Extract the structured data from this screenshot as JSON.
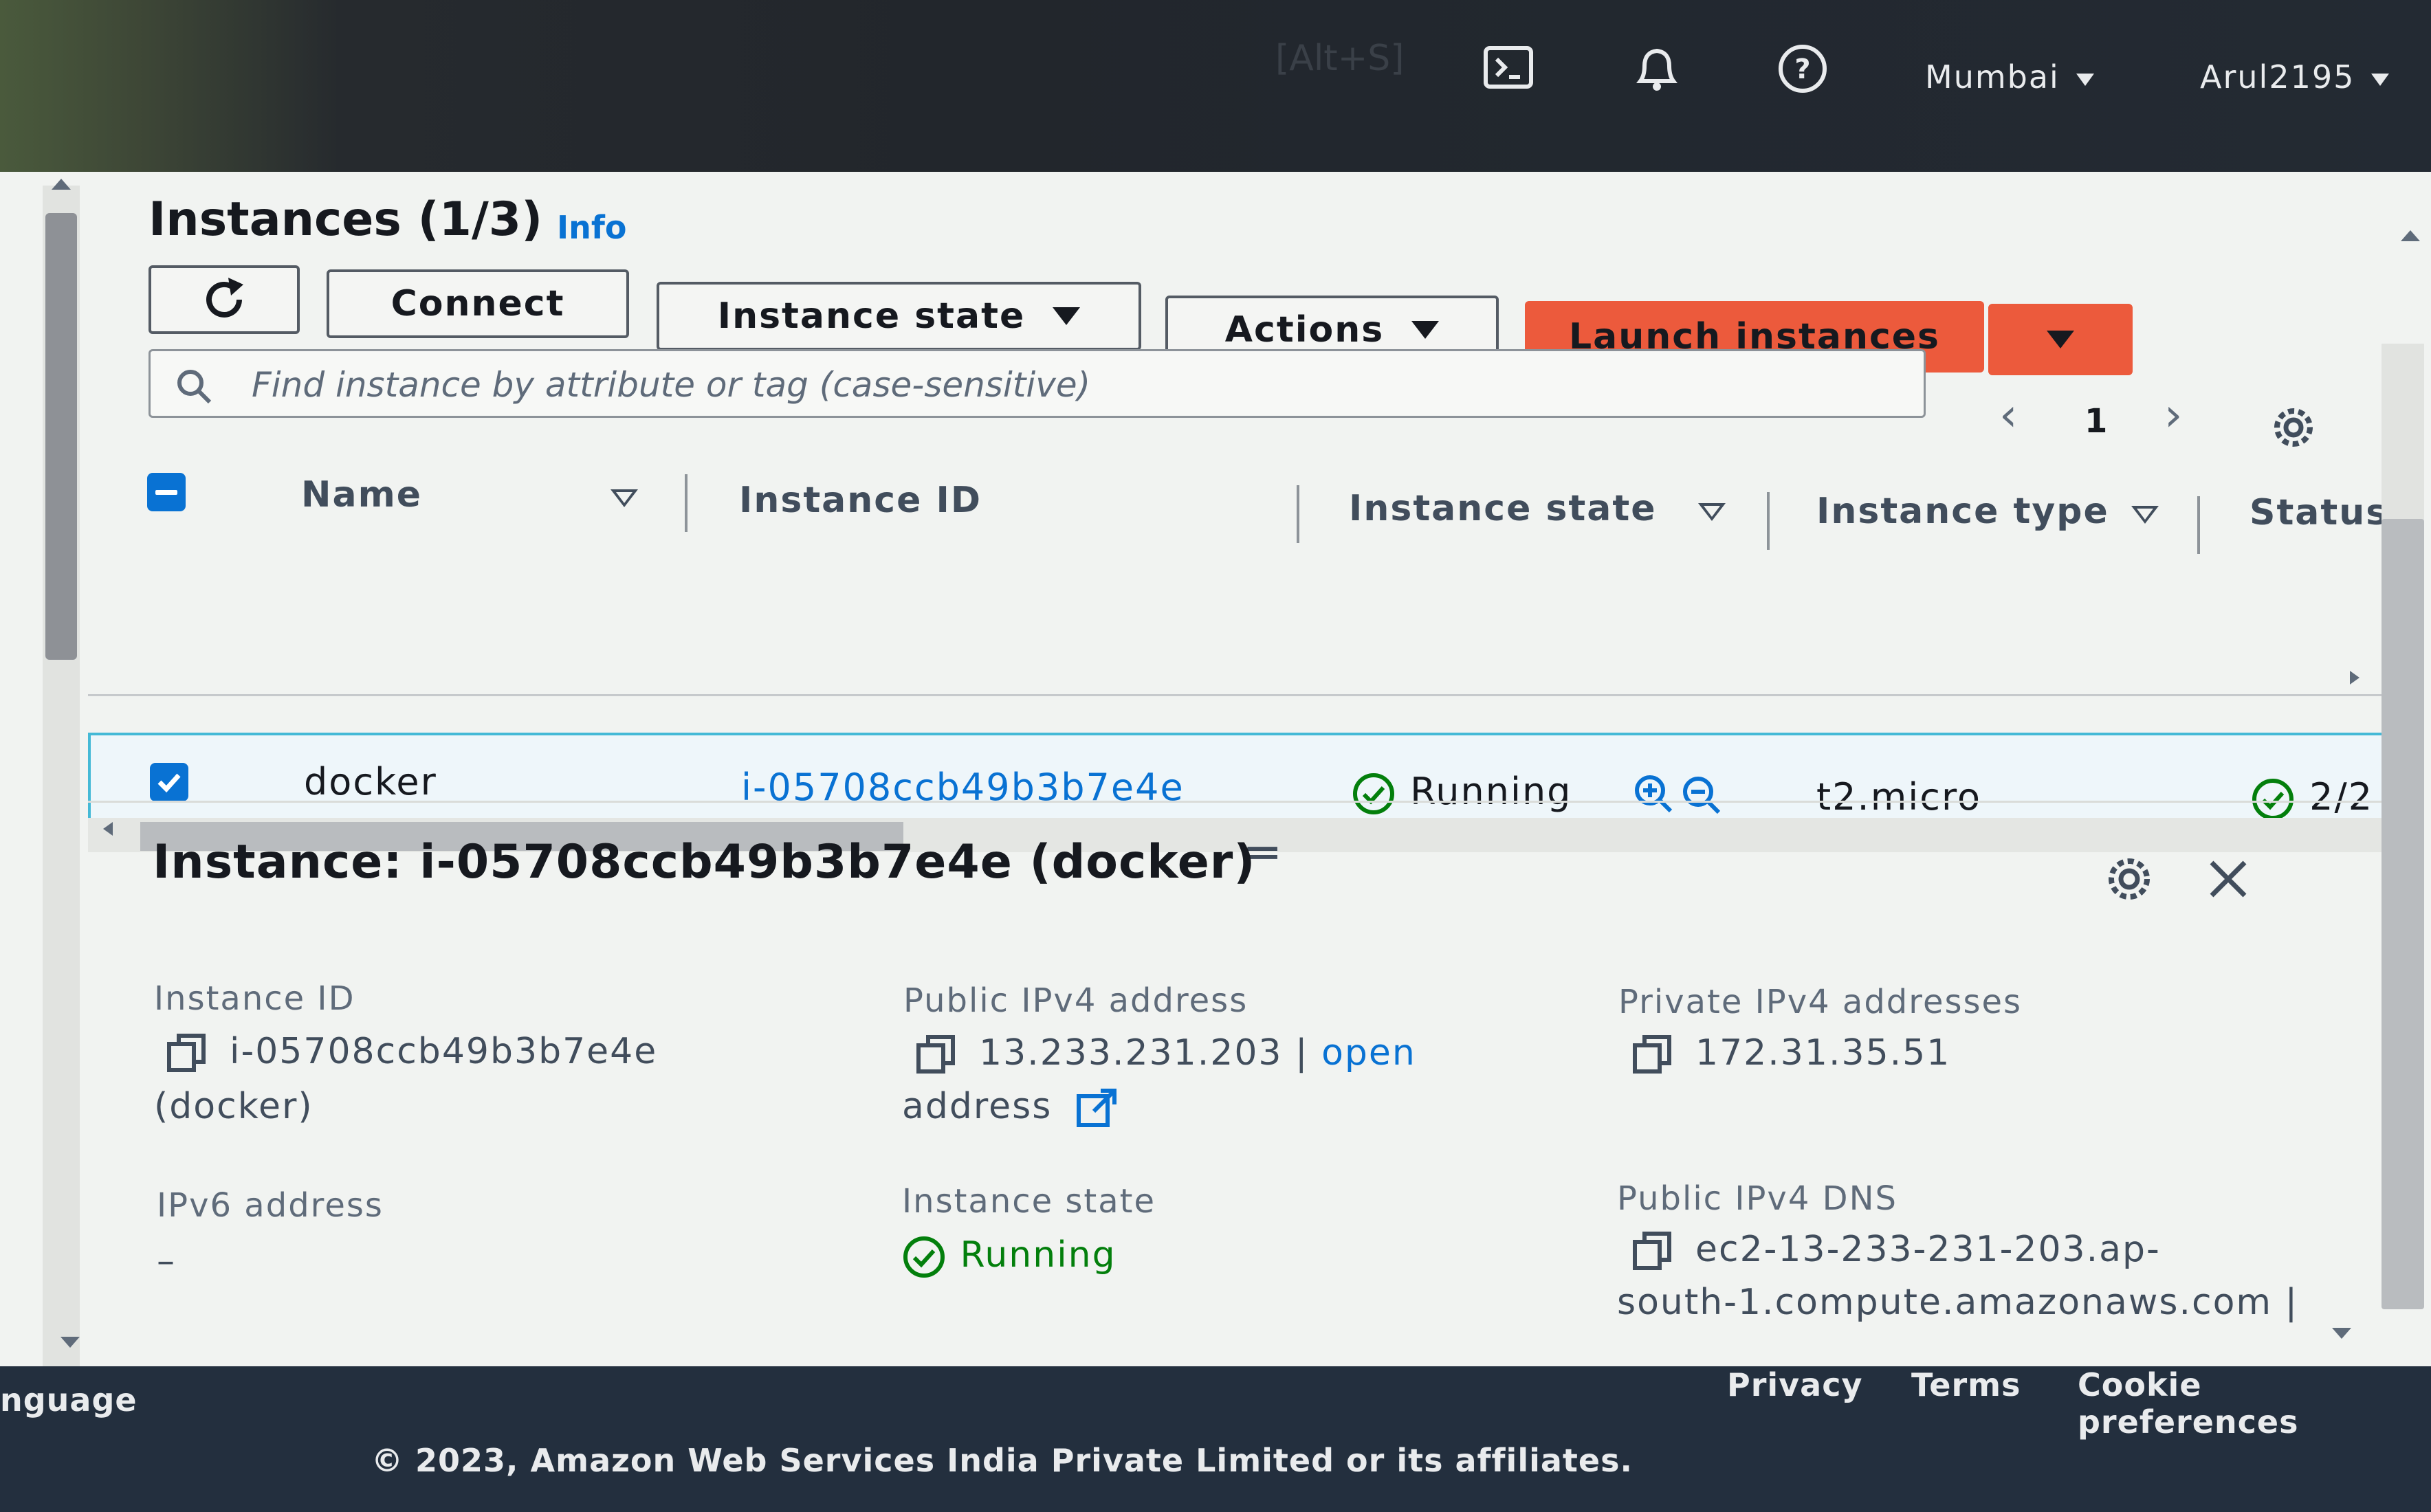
{
  "topnav": {
    "shortcut": "[Alt+S]",
    "region": "Mumbai",
    "account": "Arul2195",
    "icons": [
      "cloudshell-icon",
      "bell-icon",
      "help-icon"
    ]
  },
  "header": {
    "title": "Instances (1/3)",
    "info": "Info"
  },
  "toolbar": {
    "connect": "Connect",
    "instance_state": "Instance state",
    "actions": "Actions",
    "launch": "Launch instances"
  },
  "search": {
    "placeholder": "Find instance by attribute or tag (case-sensitive)"
  },
  "pagination": {
    "page": "1"
  },
  "table": {
    "columns": [
      "Name",
      "Instance ID",
      "Instance state",
      "Instance type",
      "Status"
    ],
    "rows": [
      {
        "name": "docker",
        "instance_id": "i-05708ccb49b3b7e4e",
        "state": "Running",
        "type": "t2.micro",
        "status": "2/2"
      }
    ]
  },
  "details": {
    "title": "Instance: i-05708ccb49b3b7e4e (docker)",
    "instance_id_label": "Instance ID",
    "instance_id_value": "i-05708ccb49b3b7e4e",
    "instance_id_name": "(docker)",
    "public_ipv4_label": "Public IPv4 address",
    "public_ipv4_value": "13.233.231.203 |",
    "open_address": "open",
    "open_address_2": "address",
    "private_ipv4_label": "Private IPv4 addresses",
    "private_ipv4_value": "172.31.35.51",
    "ipv6_label": "IPv6 address",
    "ipv6_value": "–",
    "state_label": "Instance state",
    "state_value": "Running",
    "dns_label": "Public IPv4 DNS",
    "dns_value_1": "ec2-13-233-231-203.ap-",
    "dns_value_2": "south-1.compute.amazonaws.com |"
  },
  "footer": {
    "language": "nguage",
    "privacy": "Privacy",
    "terms": "Terms",
    "cookies": "Cookie preferences",
    "copyright": "© 2023, Amazon Web Services India Private Limited or its affiliates."
  },
  "colors": {
    "primary": "#ec5a3c",
    "link": "#0972d3",
    "success": "#037f0c",
    "footer": "#232f3e"
  }
}
